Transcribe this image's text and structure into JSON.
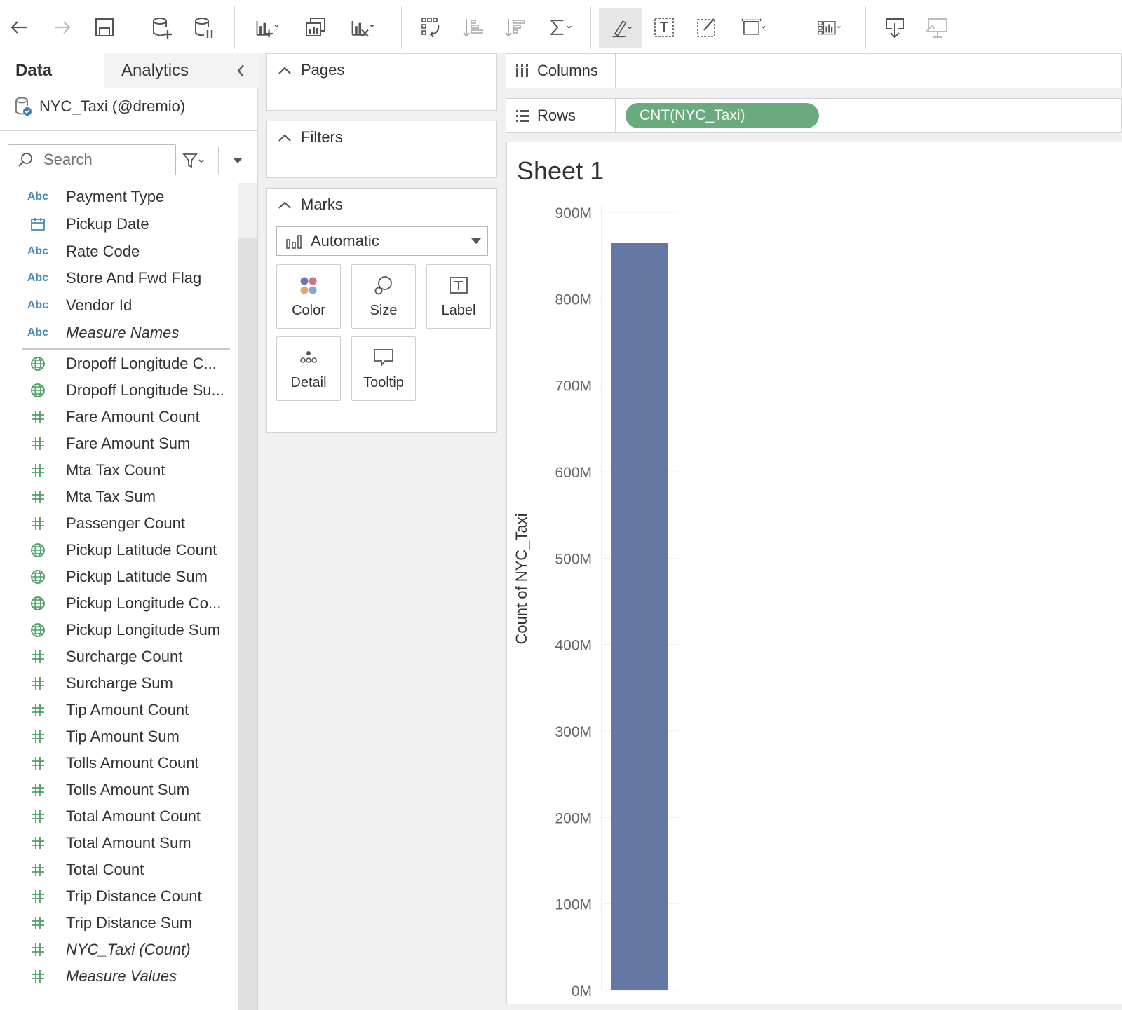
{
  "toolbar": {
    "buttons": [
      "back-icon",
      "forward-icon",
      "save-icon",
      "new-datasource-icon",
      "pause-auto-update-icon",
      "new-worksheet-icon",
      "duplicate-sheet-icon",
      "clear-sheet-icon",
      "swap-rows-columns-icon",
      "sort-ascending-icon",
      "sort-descending-icon",
      "totals-icon",
      "highlight-icon",
      "text-label-icon",
      "annotate-icon",
      "fit-icon",
      "show-me-icon",
      "download-icon",
      "presentation-mode-icon"
    ]
  },
  "data_pane": {
    "tab_data": "Data",
    "tab_analytics": "Analytics",
    "datasource": "NYC_Taxi (@dremio)",
    "search_placeholder": "Search",
    "dimensions": [
      {
        "icon": "abc",
        "label": "Payment Type",
        "italic": false
      },
      {
        "icon": "calendar",
        "label": "Pickup Date",
        "italic": false
      },
      {
        "icon": "abc",
        "label": "Rate Code",
        "italic": false
      },
      {
        "icon": "abc",
        "label": "Store And Fwd Flag",
        "italic": false
      },
      {
        "icon": "abc",
        "label": "Vendor Id",
        "italic": false
      },
      {
        "icon": "abc",
        "label": "Measure Names",
        "italic": true
      }
    ],
    "measures": [
      {
        "icon": "globe",
        "label": "Dropoff Longitude C...",
        "italic": false
      },
      {
        "icon": "globe",
        "label": "Dropoff Longitude Su...",
        "italic": false
      },
      {
        "icon": "hash",
        "label": "Fare Amount Count",
        "italic": false
      },
      {
        "icon": "hash",
        "label": "Fare Amount Sum",
        "italic": false
      },
      {
        "icon": "hash",
        "label": "Mta Tax Count",
        "italic": false
      },
      {
        "icon": "hash",
        "label": "Mta Tax Sum",
        "italic": false
      },
      {
        "icon": "hash",
        "label": "Passenger Count",
        "italic": false
      },
      {
        "icon": "globe",
        "label": "Pickup Latitude Count",
        "italic": false
      },
      {
        "icon": "globe",
        "label": "Pickup Latitude Sum",
        "italic": false
      },
      {
        "icon": "globe",
        "label": "Pickup Longitude Co...",
        "italic": false
      },
      {
        "icon": "globe",
        "label": "Pickup Longitude Sum",
        "italic": false
      },
      {
        "icon": "hash",
        "label": "Surcharge Count",
        "italic": false
      },
      {
        "icon": "hash",
        "label": "Surcharge Sum",
        "italic": false
      },
      {
        "icon": "hash",
        "label": "Tip Amount Count",
        "italic": false
      },
      {
        "icon": "hash",
        "label": "Tip Amount Sum",
        "italic": false
      },
      {
        "icon": "hash",
        "label": "Tolls Amount Count",
        "italic": false
      },
      {
        "icon": "hash",
        "label": "Tolls Amount Sum",
        "italic": false
      },
      {
        "icon": "hash",
        "label": "Total Amount Count",
        "italic": false
      },
      {
        "icon": "hash",
        "label": "Total Amount Sum",
        "italic": false
      },
      {
        "icon": "hash",
        "label": "Total Count",
        "italic": false
      },
      {
        "icon": "hash",
        "label": "Trip Distance Count",
        "italic": false
      },
      {
        "icon": "hash",
        "label": "Trip Distance Sum",
        "italic": false
      },
      {
        "icon": "hash",
        "label": "NYC_Taxi (Count)",
        "italic": true
      },
      {
        "icon": "hash",
        "label": "Measure Values",
        "italic": true
      }
    ]
  },
  "cards": {
    "pages": "Pages",
    "filters": "Filters",
    "marks": "Marks",
    "mark_type": "Automatic",
    "buttons": {
      "color": "Color",
      "size": "Size",
      "label": "Label",
      "detail": "Detail",
      "tooltip": "Tooltip"
    }
  },
  "shelves": {
    "columns": "Columns",
    "rows": "Rows",
    "rows_pill": "CNT(NYC_Taxi)"
  },
  "sheet": {
    "title": "Sheet 1"
  },
  "colors": {
    "bar": "#6577a3",
    "pill": "#6aab7d",
    "measure_icon": "#4ea065",
    "dimension_icon": "#4b8ab9"
  },
  "chart_data": {
    "type": "bar",
    "categories": [
      ""
    ],
    "values": [
      865
    ],
    "value_units": "M",
    "ylabel": "Count of NYC_Taxi",
    "ylim": [
      0,
      900
    ],
    "yticks": [
      0,
      100,
      200,
      300,
      400,
      500,
      600,
      700,
      800,
      900
    ],
    "ytick_labels": [
      "0M",
      "100M",
      "200M",
      "300M",
      "400M",
      "500M",
      "600M",
      "700M",
      "800M",
      "900M"
    ],
    "grid": true
  }
}
